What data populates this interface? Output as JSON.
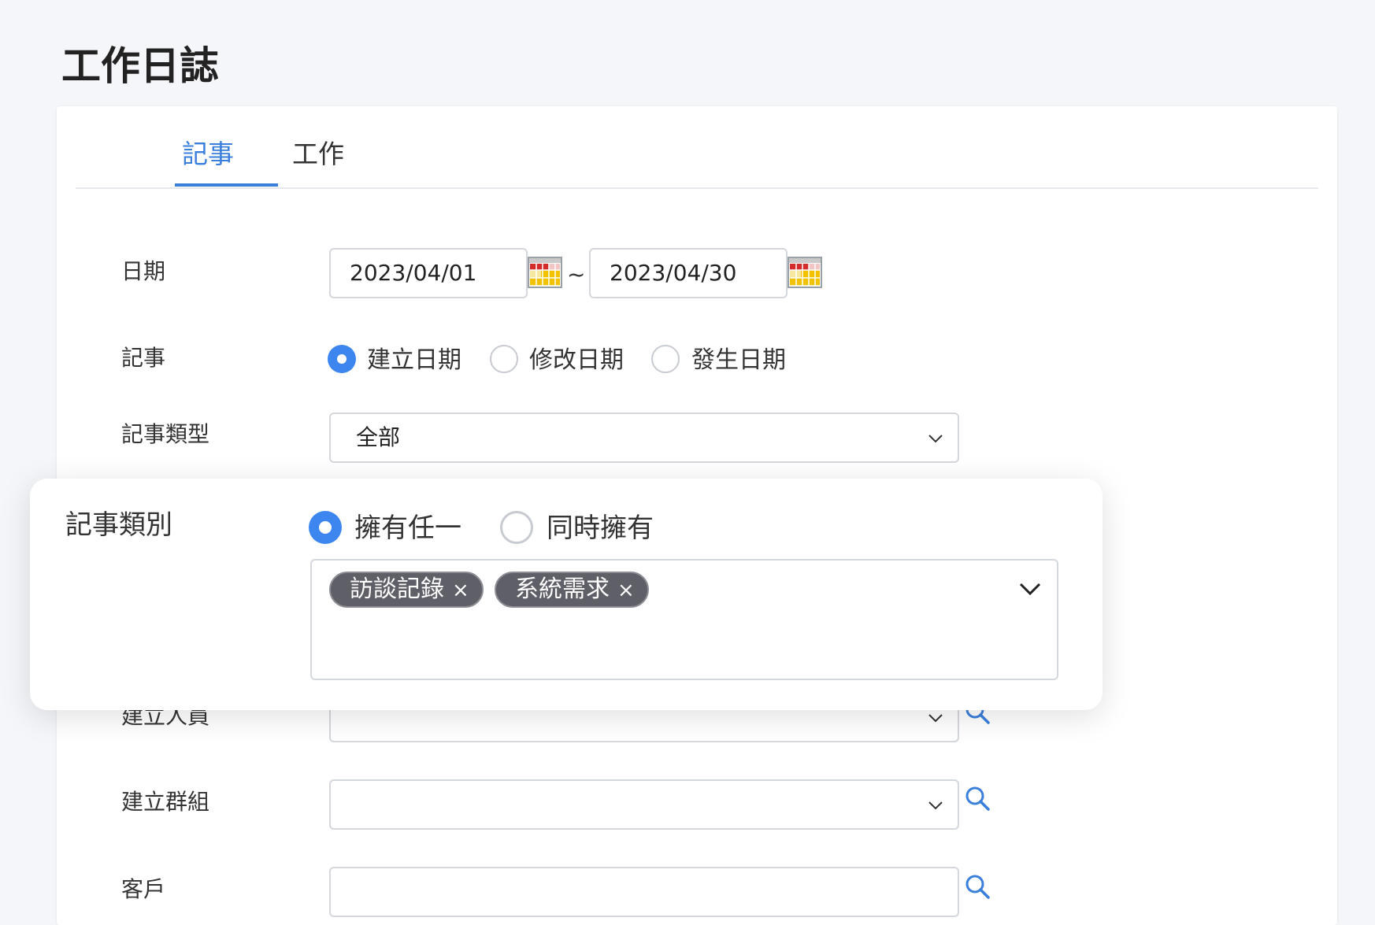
{
  "page": {
    "title": "工作日誌"
  },
  "tabs": [
    {
      "label": "記事",
      "active": true
    },
    {
      "label": "工作",
      "active": false
    }
  ],
  "form": {
    "date": {
      "label": "日期",
      "from": "2023/04/01",
      "separator": "~",
      "to": "2023/04/30"
    },
    "note": {
      "label": "記事",
      "options": [
        {
          "label": "建立日期",
          "checked": true
        },
        {
          "label": "修改日期",
          "checked": false
        },
        {
          "label": "發生日期",
          "checked": false
        }
      ]
    },
    "note_type": {
      "label": "記事類型",
      "value": "全部"
    },
    "creator": {
      "label": "建立人員",
      "value": ""
    },
    "group": {
      "label": "建立群組",
      "value": ""
    },
    "customer": {
      "label": "客戶",
      "value": ""
    }
  },
  "popup": {
    "label": "記事類別",
    "options": [
      {
        "label": "擁有任一",
        "checked": true
      },
      {
        "label": "同時擁有",
        "checked": false
      }
    ],
    "tags": [
      {
        "label": "訪談記錄",
        "remove": "×"
      },
      {
        "label": "系統需求",
        "remove": "×"
      }
    ]
  },
  "colors": {
    "accent": "#3a7fdc",
    "radio": "#3d86f0",
    "tag_bg": "#5f5f68"
  },
  "icons": [
    "calendar-icon",
    "chevron-down-icon",
    "search-icon",
    "close-icon"
  ]
}
